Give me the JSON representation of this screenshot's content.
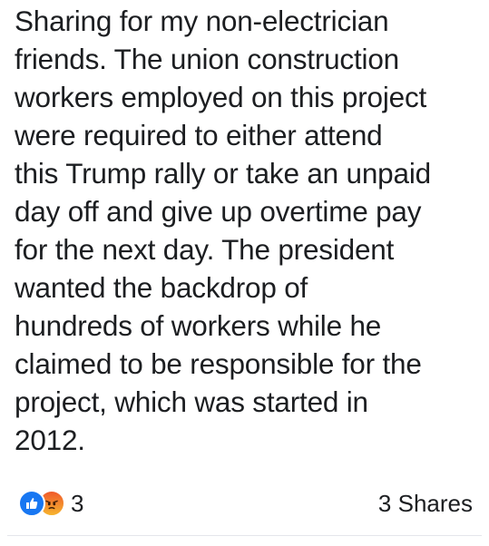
{
  "post": {
    "text_lines": [
      "Sharing for my non-electrician",
      "friends. The union construction",
      "workers employed on this project",
      "were required to either attend",
      "this Trump rally or take an unpaid",
      "day off and give up overtime pay",
      "for the next day. The president",
      "wanted the backdrop of",
      "hundreds of workers while he",
      "claimed to be responsible for the",
      "project, which was started in",
      "2012."
    ]
  },
  "footer": {
    "reactions": {
      "icons": [
        "like-icon",
        "angry-icon"
      ],
      "count": "3"
    },
    "shares_label": "3 Shares"
  },
  "colors": {
    "text": "#1c1e21",
    "like_blue": "#1877f2",
    "angry_orange": "#f05a2b",
    "divider": "#e4e6eb"
  }
}
